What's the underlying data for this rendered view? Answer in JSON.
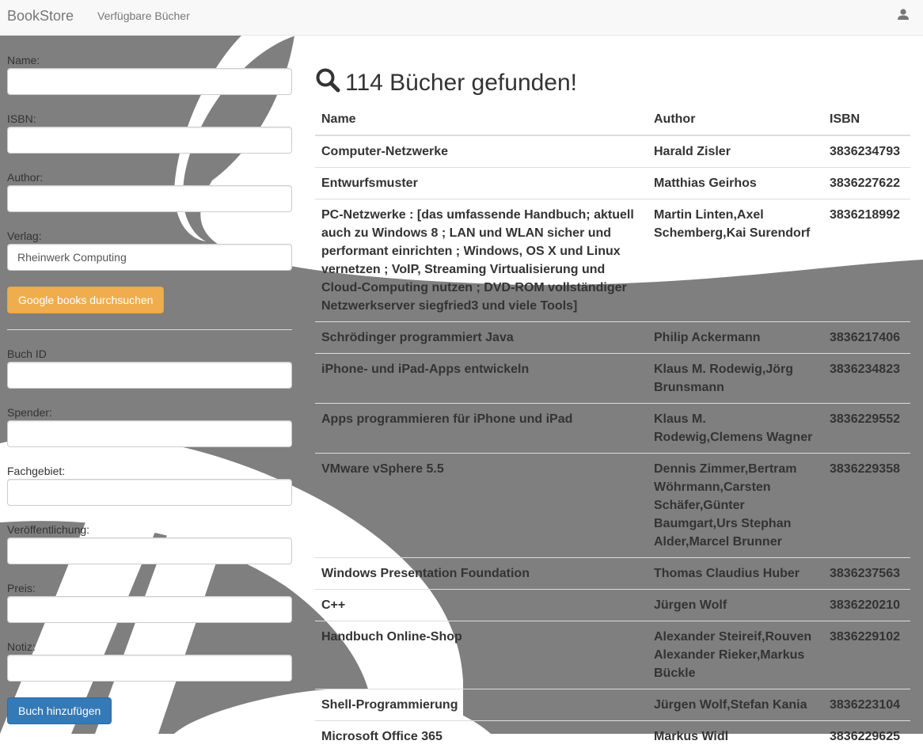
{
  "navbar": {
    "brand": "BookStore",
    "nav_link": "Verfügbare Bücher",
    "user_icon": "user-icon"
  },
  "sidebar": {
    "fields": [
      {
        "label": "Name:",
        "value": "",
        "placeholder": ""
      },
      {
        "label": "ISBN:",
        "value": "",
        "placeholder": ""
      },
      {
        "label": "Author:",
        "value": "",
        "placeholder": ""
      },
      {
        "label": "Verlag:",
        "value": "Rheinwerk Computing",
        "placeholder": ""
      }
    ],
    "search_button": "Google books durchsuchen",
    "book_fields": [
      {
        "label": "Buch ID",
        "value": ""
      },
      {
        "label": "Spender:",
        "value": ""
      },
      {
        "label": "Fachgebiet:",
        "value": ""
      },
      {
        "label": "Veröffentlichung:",
        "value": ""
      },
      {
        "label": "Preis:",
        "value": ""
      },
      {
        "label": "Notiz:",
        "value": ""
      }
    ],
    "add_button": "Buch hinzufügen"
  },
  "results": {
    "count": "114",
    "heading": "114 Bücher gefunden!",
    "search_icon": "search-icon",
    "columns": [
      "Name",
      "Author",
      "ISBN"
    ],
    "rows": [
      {
        "name": "Computer-Netzwerke",
        "author": "Harald Zisler",
        "isbn": "3836234793"
      },
      {
        "name": "Entwurfsmuster",
        "author": "Matthias Geirhos",
        "isbn": "3836227622"
      },
      {
        "name": "PC-Netzwerke : [das umfassende Handbuch; aktuell auch zu Windows 8 ; LAN und WLAN sicher und performant einrichten ; Windows, OS X und Linux vernetzen ; VoIP, Streaming Virtualisierung und Cloud-Computing nutzen ; DVD-ROM vollständiger Netzwerkserver siegfried3 und viele Tools]",
        "author": "Martin Linten,Axel Schemberg,Kai Surendorf",
        "isbn": "3836218992"
      },
      {
        "name": "Schrödinger programmiert Java",
        "author": "Philip Ackermann",
        "isbn": "3836217406"
      },
      {
        "name": "iPhone- und iPad-Apps entwickeln",
        "author": "Klaus M. Rodewig,Jörg Brunsmann",
        "isbn": "3836234823"
      },
      {
        "name": "Apps programmieren für iPhone und iPad",
        "author": "Klaus M. Rodewig,Clemens Wagner",
        "isbn": "3836229552"
      },
      {
        "name": "VMware vSphere 5.5",
        "author": "Dennis Zimmer,Bertram Wöhrmann,Carsten Schäfer,Günter Baumgart,Urs Stephan Alder,Marcel Brunner",
        "isbn": "3836229358"
      },
      {
        "name": "Windows Presentation Foundation",
        "author": "Thomas Claudius Huber",
        "isbn": "3836237563"
      },
      {
        "name": "C++",
        "author": "Jürgen Wolf",
        "isbn": "3836220210"
      },
      {
        "name": "Handbuch Online-Shop",
        "author": "Alexander Steireif,Rouven Alexander Rieker,Markus Bückle",
        "isbn": "3836229102"
      },
      {
        "name": "Shell-Programmierung",
        "author": "Jürgen Wolf,Stefan Kania",
        "isbn": "3836223104"
      },
      {
        "name": "Microsoft Office 365",
        "author": "Markus Widl",
        "isbn": "3836229625"
      }
    ]
  },
  "colors": {
    "background_shape": "#808080",
    "navbar_bg": "#f8f8f8",
    "warning": "#f0ad4e",
    "primary": "#337ab7"
  }
}
